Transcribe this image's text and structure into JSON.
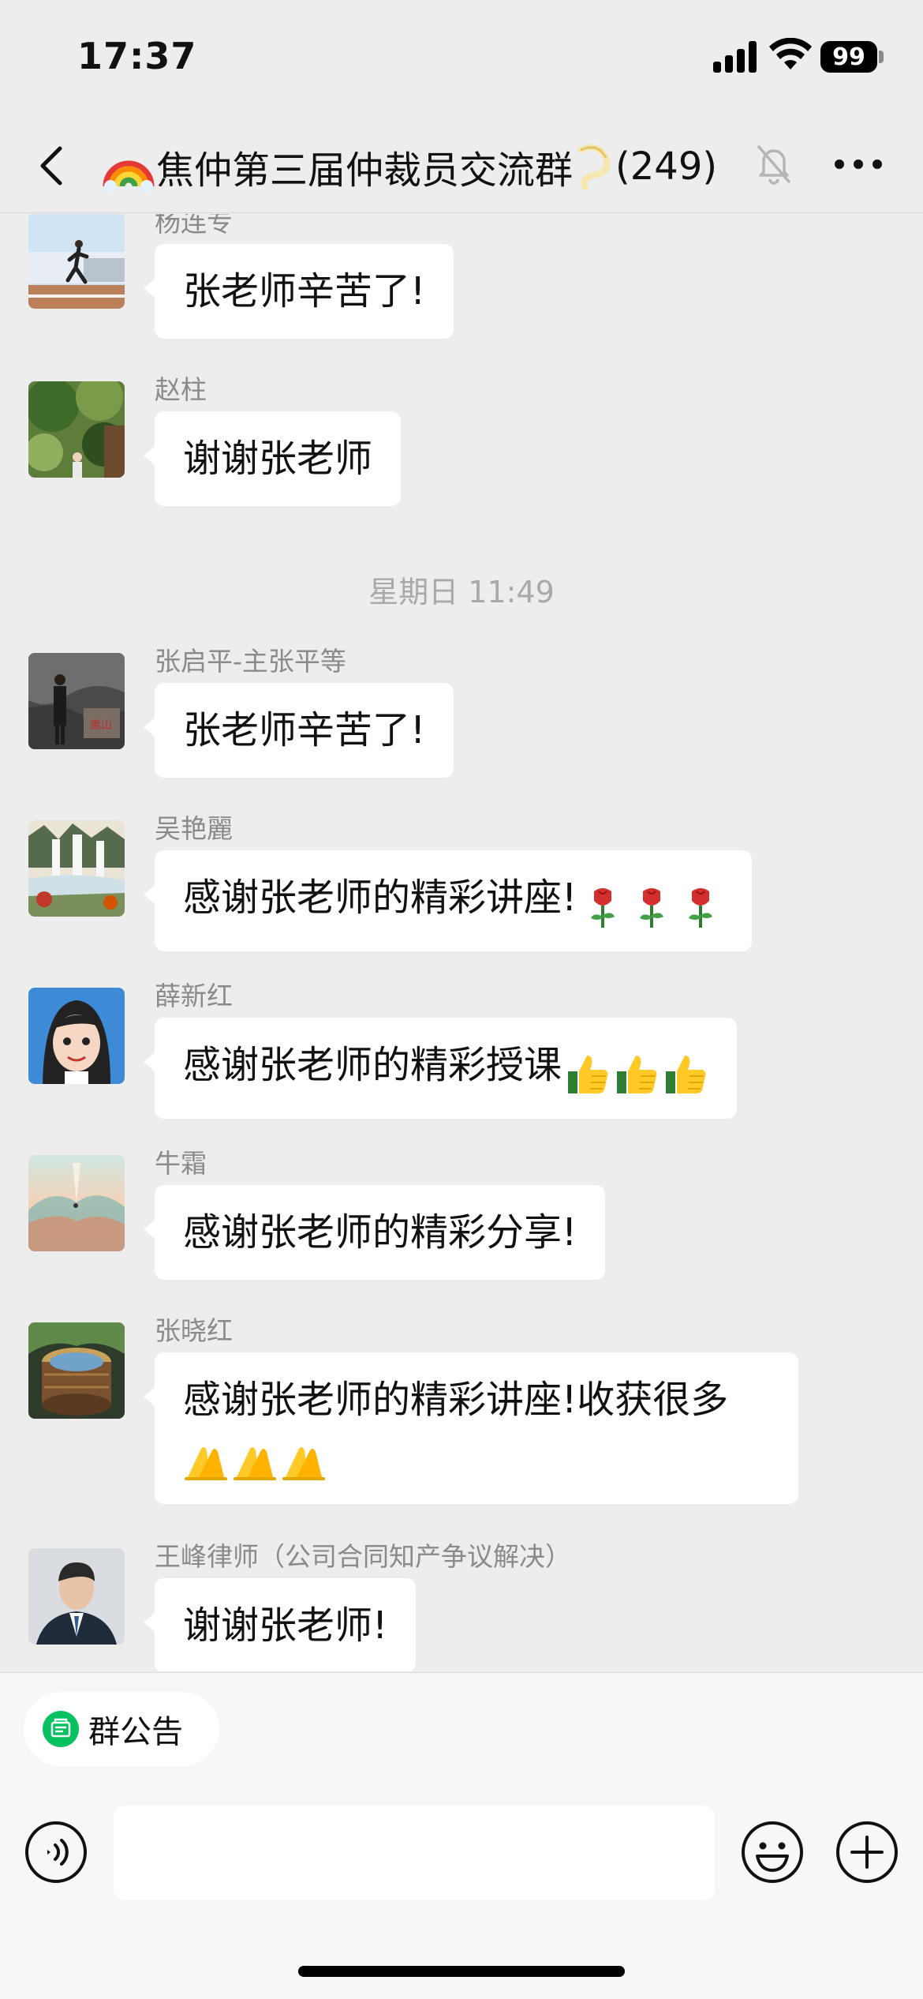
{
  "status_bar": {
    "time": "17:37",
    "battery": "99"
  },
  "header": {
    "title": "焦仲第三届仲裁员交流群",
    "member_count": "(249)",
    "icons": [
      "back-chevron-icon",
      "rainbow-emoji",
      "ribbon-emoji",
      "mute-bell-icon",
      "more-dots-icon"
    ]
  },
  "messages": [
    {
      "sender": "杨连专",
      "text": "张老师辛苦了!",
      "emojis": []
    },
    {
      "sender": "赵柱",
      "text": "谢谢张老师",
      "emojis": []
    },
    {
      "timestamp": "星期日 11:49"
    },
    {
      "sender": "张启平-主张平等",
      "text": "张老师辛苦了!",
      "emojis": []
    },
    {
      "sender": "吴艳麗",
      "text": "感谢张老师的精彩讲座!",
      "emojis": [
        "rose",
        "rose",
        "rose"
      ]
    },
    {
      "sender": "薛新红",
      "text": "感谢张老师的精彩授课",
      "emojis": [
        "thumbs-up",
        "thumbs-up",
        "thumbs-up"
      ]
    },
    {
      "sender": "牛霜",
      "text": "感谢张老师的精彩分享!",
      "emojis": []
    },
    {
      "sender": "张晓红",
      "text": "感谢张老师的精彩讲座!收获很多",
      "emojis": [
        "folded-hands",
        "folded-hands",
        "folded-hands"
      ]
    },
    {
      "sender": "王峰律师（公司合同知产争议解决）",
      "text": "谢谢张老师!",
      "emojis": []
    }
  ],
  "bottom": {
    "announcement_label": "群公告",
    "input_value": "",
    "icons": [
      "announcement-icon",
      "voice-icon",
      "emoji-icon",
      "plus-icon"
    ]
  },
  "colors": {
    "chat_background": "#ededed",
    "bubble": "#ffffff",
    "announcement_green": "#07c160",
    "meta_text": "#8a8a8a"
  }
}
